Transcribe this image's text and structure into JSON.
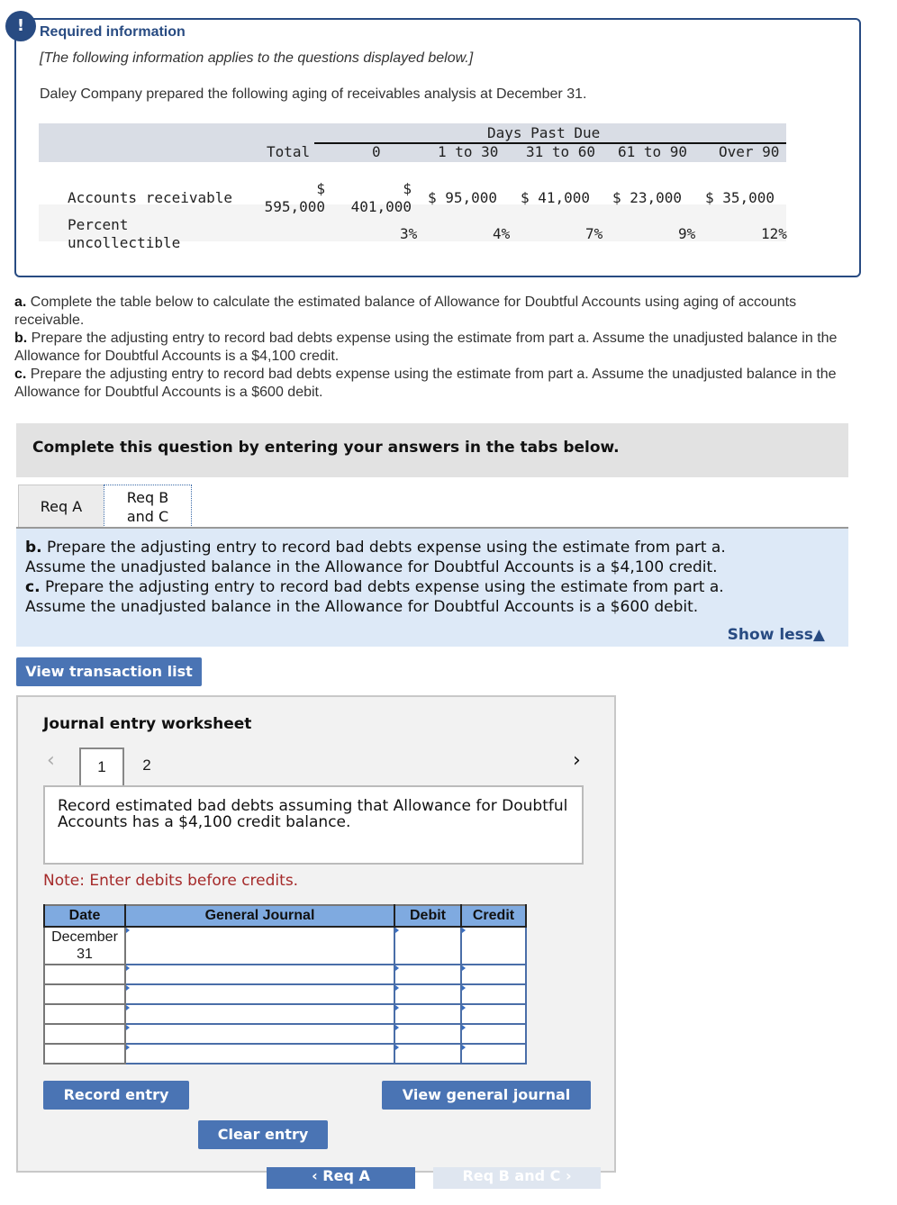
{
  "required_info": {
    "badge": "!",
    "title": "Required information",
    "applies_note": "[The following information applies to the questions displayed below.]",
    "intro": "Daley Company prepared the following aging of receivables analysis at December 31."
  },
  "aging_table": {
    "group_header": "Days Past Due",
    "columns": [
      "Total",
      "0",
      "1 to 30",
      "31 to 60",
      "61 to 90",
      "Over 90"
    ],
    "rows": [
      {
        "label": "Accounts receivable",
        "cells": [
          "$\n595,000",
          "$\n401,000",
          "$ 95,000",
          "$ 41,000",
          "$ 23,000",
          "$ 35,000"
        ]
      },
      {
        "label": "Percent\nuncollectible",
        "cells": [
          "",
          "3%",
          "4%",
          "7%",
          "9%",
          "12%"
        ]
      }
    ]
  },
  "questions": {
    "a_label": "a.",
    "a_text": " Complete the table below to calculate the estimated balance of Allowance for Doubtful Accounts using aging of accounts receivable.",
    "b_label": "b.",
    "b_text": " Prepare the adjusting entry to record bad debts expense using the estimate from part a. Assume the unadjusted balance in the Allowance for Doubtful Accounts is a $4,100 credit.",
    "c_label": "c.",
    "c_text": " Prepare the adjusting entry to record bad debts expense using the estimate from part a. Assume the unadjusted balance in the Allowance for Doubtful Accounts is a $600 debit."
  },
  "complete_banner": "Complete this question by entering your answers in the tabs below.",
  "tabs": [
    {
      "label": "Req A"
    },
    {
      "label": "Req B and C",
      "line1": "Req B",
      "line2": "and C",
      "active": true
    }
  ],
  "instructions": {
    "b_label": "b.",
    "b_line1": " Prepare the adjusting entry to record bad debts expense using the estimate from part a.",
    "b_line2": "Assume the unadjusted balance in the Allowance for Doubtful Accounts is a $4,100 credit.",
    "c_label": "c.",
    "c_line1": " Prepare the adjusting entry to record bad debts expense using the estimate from part a.",
    "c_line2": "Assume the unadjusted balance in the Allowance for Doubtful Accounts is a $600 debit.",
    "show_less": "Show less▲"
  },
  "buttons": {
    "view_transaction_list": "View transaction list",
    "record_entry": "Record entry",
    "clear_entry": "Clear entry",
    "view_general_journal": "View general journal"
  },
  "worksheet": {
    "title": "Journal entry worksheet",
    "prev_icon": "‹",
    "next_icon": "›",
    "pages": [
      "1",
      "2"
    ],
    "current_page": "1",
    "description": "Record estimated bad debts assuming that Allowance for Doubtful Accounts has a $4,100 credit balance.",
    "note": "Note: Enter debits before credits.",
    "table": {
      "headers": [
        "Date",
        "General Journal",
        "Debit",
        "Credit"
      ],
      "rows": [
        {
          "date": "December\n31",
          "account": "",
          "debit": "",
          "credit": ""
        },
        {
          "date": "",
          "account": "",
          "debit": "",
          "credit": ""
        },
        {
          "date": "",
          "account": "",
          "debit": "",
          "credit": ""
        },
        {
          "date": "",
          "account": "",
          "debit": "",
          "credit": ""
        },
        {
          "date": "",
          "account": "",
          "debit": "",
          "credit": ""
        },
        {
          "date": "",
          "account": "",
          "debit": "",
          "credit": ""
        }
      ]
    }
  },
  "bottom_nav": {
    "prev": "‹  Req A",
    "next": "Req B and C  ›"
  }
}
